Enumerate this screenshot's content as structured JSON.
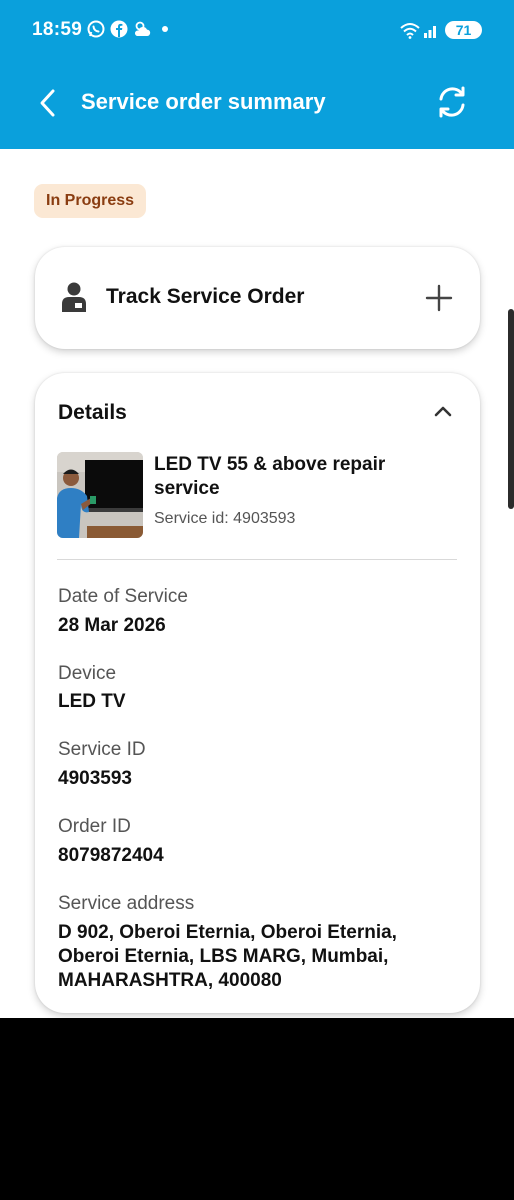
{
  "status_bar": {
    "time": "18:59",
    "battery": "71",
    "icons": [
      "whatsapp-icon",
      "facebook-icon",
      "weather-icon",
      "dot-icon",
      "wifi-icon",
      "signal-icon"
    ]
  },
  "header": {
    "title": "Service order summary",
    "back_icon": "chevron-left-icon",
    "refresh_icon": "refresh-icon",
    "background_color": "#0aa0dc"
  },
  "status_badge": {
    "label": "In Progress",
    "background_color": "#fbe8d4",
    "text_color": "#8a3d11"
  },
  "track_card": {
    "title": "Track Service Order",
    "icon": "person-icon",
    "expand_icon": "plus-icon"
  },
  "details": {
    "title": "Details",
    "collapse_icon": "chevron-up-icon",
    "product": {
      "name": "LED TV 55 & above repair service",
      "service_id_text": "Service id: 4903593"
    },
    "fields": [
      {
        "label": "Date of Service",
        "value": "28 Mar 2026"
      },
      {
        "label": "Device",
        "value": "LED TV"
      },
      {
        "label": "Service ID",
        "value": "4903593"
      },
      {
        "label": "Order ID",
        "value": "8079872404"
      },
      {
        "label": "Service address",
        "value": "D 902, Oberoi Eternia, Oberoi Eternia, Oberoi Eternia, LBS MARG, Mumbai, MAHARASHTRA, 400080"
      }
    ]
  }
}
